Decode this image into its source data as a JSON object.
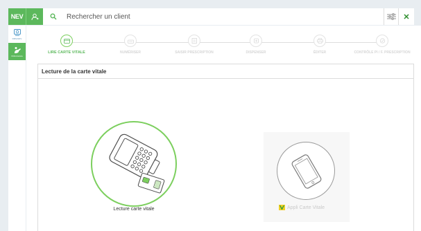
{
  "topbar": {
    "logo_text": "NEV",
    "search_placeholder": "Rechercher un client"
  },
  "sidebar": {
    "items": [
      {
        "label": "DMV/ADV",
        "icon": "card-reader-icon",
        "active": false
      },
      {
        "label": "Ordonnance",
        "icon": "prescription-icon",
        "active": true
      }
    ]
  },
  "steps": [
    {
      "label": "Lire carte vitale",
      "icon": "card-icon",
      "active": true
    },
    {
      "label": "Numériser",
      "icon": "scanner-icon",
      "active": false
    },
    {
      "label": "Saisir prescription",
      "icon": "edit-icon",
      "active": false
    },
    {
      "label": "Dispenser",
      "icon": "pill-icon",
      "active": false
    },
    {
      "label": "Éditer",
      "icon": "print-icon",
      "active": false
    },
    {
      "label": "Contrôle PI / F. prescription",
      "icon": "check-icon",
      "active": false
    }
  ],
  "card": {
    "title": "Lecture de la carte vitale"
  },
  "options": {
    "reader_label": "Lecture carte vitale",
    "app_label": "Appli Carte Vitale"
  },
  "colors": {
    "accent": "#5cb85c",
    "circle_active": "#7ccf5e"
  }
}
